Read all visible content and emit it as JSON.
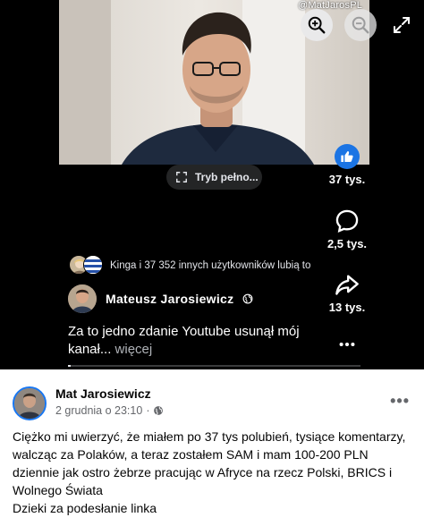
{
  "video": {
    "watermark": "@MatJarosPL",
    "fullscreen_label": "Tryb pełno...",
    "progress": 0.01
  },
  "actions": {
    "likes_count": "37 tys.",
    "comments_count": "2,5 tys.",
    "shares_count": "13 tys."
  },
  "reel": {
    "likers_text": "Kinga i 37 352 innych użytkowników lubią to",
    "author": "Mateusz Jarosiewicz",
    "caption": "Za to jedno zdanie Youtube usunął mój kanał...",
    "caption_more": "więcej"
  },
  "post": {
    "author": "Mat Jarosiewicz",
    "date": "2 grudnia o 23:10",
    "separator": "·",
    "more_label": "•••",
    "paragraph_1": "Ciężko mi uwierzyć, że miałem po 37 tys polubień, tysiące komentarzy, walcząc za Polaków, a teraz zostałem SAM i mam 100-200 PLN dziennie jak ostro żebrze pracując w Afryce na rzecz Polski, BRICS i Wolnego Świata",
    "paragraph_2": "Dzieki za podesłanie linka"
  },
  "colors": {
    "accent": "#1877f2",
    "like_blue": "#1b74e4",
    "reel_bg": "#000000"
  },
  "icons": [
    "zoom-in-icon",
    "zoom-out-icon",
    "expand-icon",
    "fullscreen-icon",
    "like-icon",
    "comment-icon",
    "share-icon",
    "more-icon",
    "globe-icon"
  ]
}
